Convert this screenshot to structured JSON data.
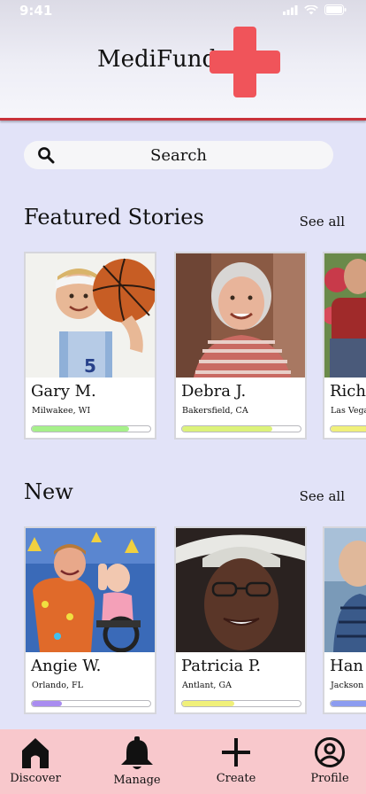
{
  "status": {
    "time": "9:41"
  },
  "app": {
    "title": "MediFund"
  },
  "search": {
    "placeholder": "Search"
  },
  "featured": {
    "title": "Featured Stories",
    "see_all": "See all",
    "cards": [
      {
        "name": "Gary M.",
        "location": "Milwakee, WI",
        "progress": 0.82,
        "color": "#a6f08a"
      },
      {
        "name": "Debra J.",
        "location": "Bakersfield, CA",
        "progress": 0.76,
        "color": "#dcf27a"
      },
      {
        "name": "Rich",
        "location": "Las Vega",
        "progress": 0.6,
        "color": "#f0f07a"
      }
    ]
  },
  "new": {
    "title": "New",
    "see_all": "See all",
    "cards": [
      {
        "name": "Angie W.",
        "location": "Orlando, FL",
        "progress": 0.25,
        "color": "#a98cf0"
      },
      {
        "name": "Patricia P.",
        "location": "Antlant, GA",
        "progress": 0.44,
        "color": "#f0f07a"
      },
      {
        "name": "Han",
        "location": "Jackson",
        "progress": 0.5,
        "color": "#8c9cf0"
      }
    ]
  },
  "tabs": [
    {
      "label": "Discover",
      "icon": "home-icon"
    },
    {
      "label": "Manage",
      "icon": "bell-icon"
    },
    {
      "label": "Create",
      "icon": "plus-icon"
    },
    {
      "label": "Profile",
      "icon": "user-circle-icon"
    }
  ]
}
